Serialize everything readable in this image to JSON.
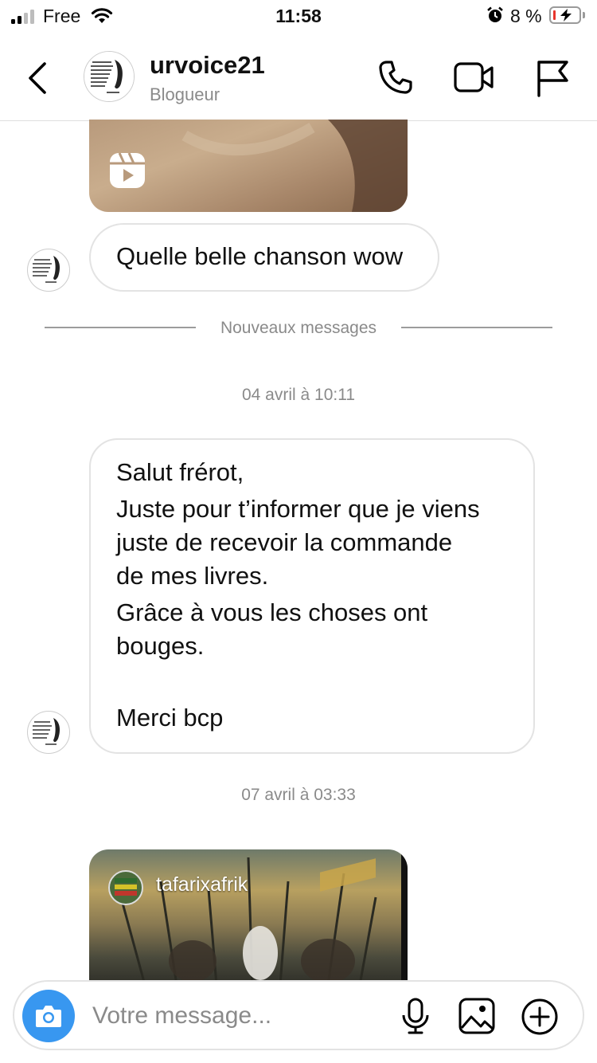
{
  "status_bar": {
    "carrier": "Free",
    "time": "11:58",
    "battery_percent": "8 %",
    "battery_level": 0.08
  },
  "header": {
    "username": "urvoice21",
    "subtitle": "Blogueur"
  },
  "messages": {
    "first": "Quelle belle chanson wow",
    "new_messages_label": "Nouveaux messages",
    "timestamp_1": "04 avril à 10:11",
    "second": {
      "lines": [
        "Salut frérot,",
        "Juste pour t’informer que je viens",
        "juste de recevoir la commande",
        "de mes livres.",
        "Grâce à vous les choses ont",
        "bouges.",
        "Merci bcp"
      ]
    },
    "timestamp_2": "07 avril à 03:33",
    "shared_post_owner": "tafarixafrik"
  },
  "composer": {
    "placeholder": "Votre message..."
  },
  "icons": {
    "back": "chevron-left-icon",
    "call": "phone-icon",
    "video": "video-camera-icon",
    "report": "flag-icon",
    "reel": "reel-icon",
    "camera": "camera-icon",
    "mic": "microphone-icon",
    "gallery": "image-icon",
    "more": "plus-circle-icon"
  },
  "colors": {
    "accent": "#3897f0",
    "battery_low": "#e8352c"
  }
}
